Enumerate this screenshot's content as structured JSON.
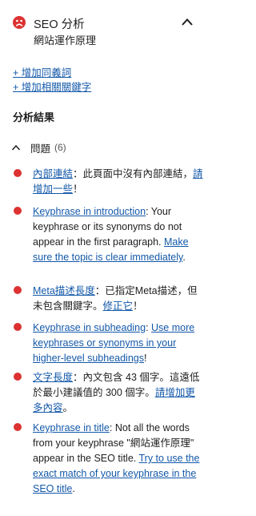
{
  "header": {
    "title": "SEO 分析",
    "subtitle": "網站運作原理",
    "status_icon": "sad-face-icon",
    "status_color": "#dc3232",
    "collapse_icon": "chevron-up-icon"
  },
  "links": {
    "add_synonyms": "+ 增加同義詞",
    "add_related": "+ 增加相關關鍵字"
  },
  "analysis": {
    "title": "分析結果",
    "problems_label": "問題",
    "problems_count": "(6)",
    "bullet_color": "#dc3232",
    "items": [
      {
        "parts": [
          {
            "t": "內部連結",
            "link": true
          },
          {
            "t": "：此頁面中沒有內部連結，",
            "link": false
          },
          {
            "t": "請增加一些",
            "link": true
          },
          {
            "t": "！",
            "link": false
          }
        ]
      },
      {
        "parts": [
          {
            "t": "Keyphrase in introduction",
            "link": true
          },
          {
            "t": ": Your keyphrase or its synonyms do not appear in the first paragraph. ",
            "link": false
          },
          {
            "t": "Make sure the topic is clear immediately",
            "link": true
          },
          {
            "t": ".",
            "link": false
          }
        ]
      },
      {
        "parts": [
          {
            "t": "Meta描述長度",
            "link": true
          },
          {
            "t": "：已指定Meta描述，但未包含關鍵字。",
            "link": false
          },
          {
            "t": "修正它",
            "link": true
          },
          {
            "t": "！",
            "link": false
          }
        ]
      },
      {
        "parts": [
          {
            "t": "Keyphrase in subheading",
            "link": true
          },
          {
            "t": ": ",
            "link": false
          },
          {
            "t": "Use more keyphrases or synonyms in your higher-level subheadings",
            "link": true
          },
          {
            "t": "!",
            "link": false
          }
        ]
      },
      {
        "parts": [
          {
            "t": "文字長度",
            "link": true
          },
          {
            "t": "：內文包含 43 個字。這遠低於最小建議值的 300 個字。",
            "link": false
          },
          {
            "t": "請增加更多內容",
            "link": true
          },
          {
            "t": "。",
            "link": false
          }
        ]
      },
      {
        "parts": [
          {
            "t": "Keyphrase in title",
            "link": true
          },
          {
            "t": ": Not all the words from your keyphrase \"網站運作原理\" appear in the SEO title. ",
            "link": false
          },
          {
            "t": "Try to use the exact match of your keyphrase in the SEO title",
            "link": true
          },
          {
            "t": ".",
            "link": false
          }
        ]
      }
    ]
  }
}
